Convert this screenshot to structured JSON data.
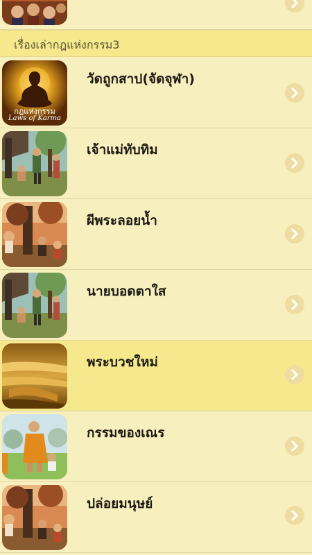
{
  "section": {
    "title": "เรื่องเล่ากฎแห่งกรรม3"
  },
  "items": [
    {
      "title": "",
      "thumb": "temple-painting-thumbnail"
    },
    {
      "title": "วัดถูกสาป(จัดจุฬา)",
      "thumb": "buddha-laws-of-karma-thumbnail",
      "thumb_caption_th": "กฎแห่งกรรม",
      "thumb_caption_en": "Laws of Karma"
    },
    {
      "title": "เจ้าแม่ทับทิม",
      "thumb": "village-painting-thumbnail"
    },
    {
      "title": "ผีพระลอยน้ำ",
      "thumb": "forest-painting-thumbnail"
    },
    {
      "title": "นายบอดตาใส",
      "thumb": "village-painting-thumbnail"
    },
    {
      "title": "พระบวชใหม่",
      "thumb": "golden-buddha-hand-thumbnail"
    },
    {
      "title": "กรรมของเณร",
      "thumb": "novice-monk-painting-thumbnail"
    },
    {
      "title": "ปล่อยมนุษย์",
      "thumb": "forest-painting-thumbnail"
    }
  ],
  "colors": {
    "background": "#f8efbe",
    "highlight": "#f6e98d",
    "chevron": "#eedca0"
  }
}
